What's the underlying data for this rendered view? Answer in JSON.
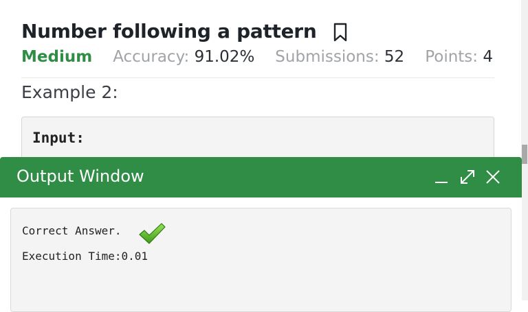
{
  "problem": {
    "title": "Number following a pattern",
    "difficulty": "Medium",
    "accuracy_label": "Accuracy:",
    "accuracy_value": "91.02%",
    "submissions_label": "Submissions:",
    "submissions_value": "52",
    "points_label": "Points:",
    "points_value": "4"
  },
  "example": {
    "heading": "Example 2:",
    "input_label": "Input:"
  },
  "output_window": {
    "title": "Output Window",
    "line1": "Correct Answer.",
    "line2": "Execution Time:0.01"
  },
  "icons": {
    "bookmark": "bookmark-icon",
    "minimize": "minimize-icon",
    "maximize": "maximize-icon",
    "close": "close-icon",
    "check": "checkmark-icon"
  },
  "colors": {
    "brand_green": "#2f8d46",
    "title_text": "#1e2229",
    "muted_text": "#a0a3a8"
  }
}
